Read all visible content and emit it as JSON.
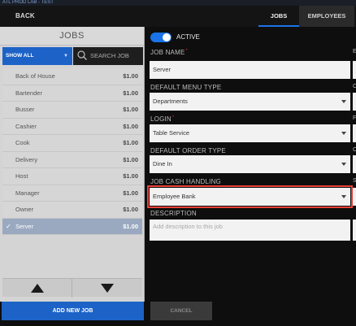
{
  "app": {
    "title": "ATL PROD LAB - TEST"
  },
  "topbar": {
    "back_label": "BACK",
    "tabs": [
      {
        "label": "JOBS",
        "active": true
      },
      {
        "label": "EMPLOYEES",
        "active": false
      }
    ]
  },
  "sidebar": {
    "header": "JOBS",
    "filter_label": "SHOW ALL",
    "search_placeholder": "SEARCH JOB",
    "jobs": [
      {
        "name": "Back of House",
        "price": "$1.00",
        "selected": false
      },
      {
        "name": "Bartender",
        "price": "$1.00",
        "selected": false
      },
      {
        "name": "Busser",
        "price": "$1.00",
        "selected": false
      },
      {
        "name": "Cashier",
        "price": "$1.00",
        "selected": false
      },
      {
        "name": "Cook",
        "price": "$1.00",
        "selected": false
      },
      {
        "name": "Delivery",
        "price": "$1.00",
        "selected": false
      },
      {
        "name": "Host",
        "price": "$1.00",
        "selected": false
      },
      {
        "name": "Manager",
        "price": "$1.00",
        "selected": false
      },
      {
        "name": "Owner",
        "price": "$1.00",
        "selected": false
      },
      {
        "name": "Server",
        "price": "$1.00",
        "selected": true
      }
    ],
    "add_button": "ADD NEW JOB"
  },
  "form": {
    "active_label": "ACTIVE",
    "active": true,
    "job_name_label": "JOB NAME",
    "job_name_value": "Server",
    "menu_type_label": "DEFAULT MENU TYPE",
    "menu_type_value": "Departments",
    "login_label": "LOGIN",
    "login_value": "Table Service",
    "order_type_label": "DEFAULT ORDER TYPE",
    "order_type_value": "Dine In",
    "cash_handling_label": "JOB CASH HANDLING",
    "cash_handling_value": "Employee Bank",
    "description_label": "DESCRIPTION",
    "description_placeholder": "Add description to this job",
    "cancel_label": "CANCEL"
  },
  "edge_column": {
    "labels": [
      "E",
      "C",
      "F",
      "C",
      "S"
    ]
  },
  "colors": {
    "accent": "#1a73e8",
    "button_blue": "#1d63c7",
    "highlight": "#e8413a",
    "selected_row": "#9aa9c0"
  }
}
